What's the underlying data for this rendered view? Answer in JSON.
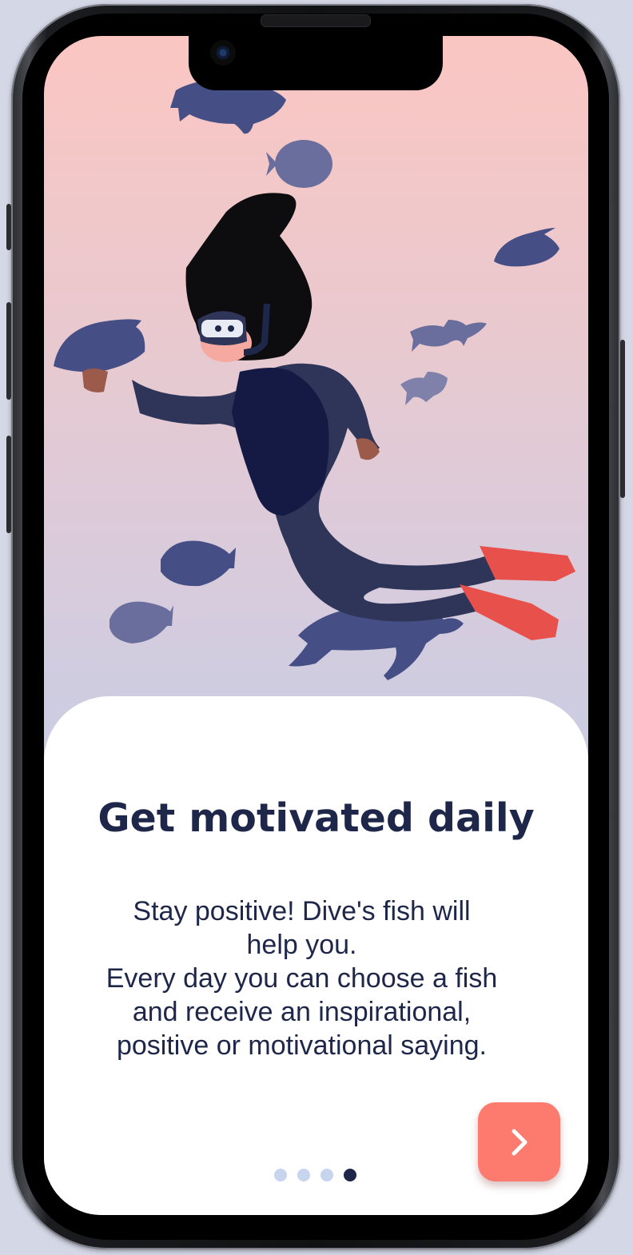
{
  "onboarding": {
    "title": "Get motivated daily",
    "description_lines": [
      "Stay positive! Dive's fish will",
      "help you.",
      "Every day you can choose a fish",
      "and receive an inspirational,",
      "positive or motivational saying."
    ],
    "next_button_icon": "chevron-right-icon",
    "page_indicator": {
      "total": 4,
      "current": 4
    }
  },
  "colors": {
    "accent": "#fc7a6e",
    "text": "#1e2749",
    "dot_inactive": "#c6d4ee",
    "dot_active": "#1e2749",
    "fish": "#464f85",
    "bg_top": "#fbc6c2",
    "bg_bottom": "#c6cde3"
  },
  "illustration": {
    "subject": "diver-illustration"
  }
}
